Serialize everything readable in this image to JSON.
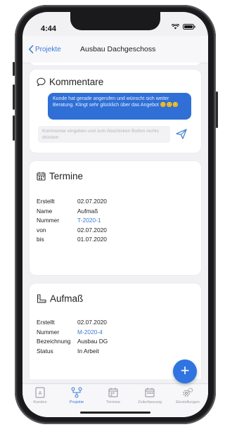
{
  "status_bar": {
    "time": "4:44"
  },
  "navbar": {
    "back_label": "Projekte",
    "title": "Ausbau Dachgeschoss"
  },
  "comments": {
    "title": "Kommentare",
    "message": "Kunde hat gerade angerufen und wünscht sich weiter Beratung. Klingt sehr glücklich über das Angebot 😊😊😊",
    "input_placeholder": "Kommentar eingeben und zum Abschicken Button rechts drücken"
  },
  "termine": {
    "title": "Termine",
    "rows": [
      {
        "key": "Erstellt",
        "value": "02.07.2020"
      },
      {
        "key": "Name",
        "value": "Aufmaß"
      },
      {
        "key": "Nummer",
        "value": "T-2020-1"
      },
      {
        "key": "von",
        "value": "02.07.2020"
      },
      {
        "key": "bis",
        "value": "01.07.2020"
      }
    ]
  },
  "aufmass": {
    "title": "Aufmaß",
    "rows": [
      {
        "key": "Erstellt",
        "value": "02.07.2020"
      },
      {
        "key": "Nummer",
        "value": "M-2020-4"
      },
      {
        "key": "Bezeichnung",
        "value": "Ausbau DG"
      },
      {
        "key": "Status",
        "value": "In Arbeit"
      }
    ]
  },
  "fab": {
    "label": "+"
  },
  "tabs": [
    {
      "label": "Kunden",
      "icon": "contact-icon"
    },
    {
      "label": "Projekte",
      "icon": "projects-icon"
    },
    {
      "label": "Termine",
      "icon": "calendar-icon"
    },
    {
      "label": "Zeiterfassung",
      "icon": "calendar-icon"
    },
    {
      "label": "Einstellungen",
      "icon": "gear-icon"
    }
  ],
  "colors": {
    "accent": "#3b7bd4",
    "bubble": "#2f6fd6",
    "background": "#f1f1f4"
  }
}
